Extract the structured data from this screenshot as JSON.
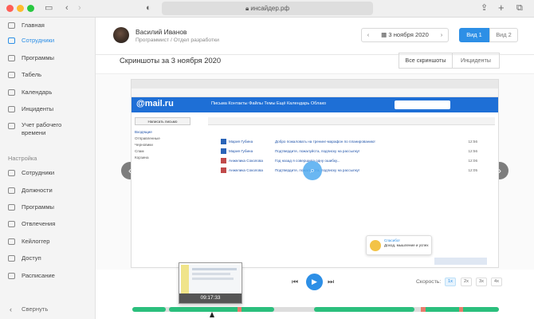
{
  "browser": {
    "address": "инсайдер.рф",
    "traffic_colors": [
      "#fe5f57",
      "#febc2e",
      "#28c840"
    ]
  },
  "sidebar": {
    "items": [
      {
        "label": "Главная",
        "icon": "home-icon"
      },
      {
        "label": "Сотрудники",
        "icon": "users-icon",
        "active": true
      },
      {
        "label": "Программы",
        "icon": "apps-icon"
      },
      {
        "label": "Табель",
        "icon": "table-icon"
      },
      {
        "label": "Календарь",
        "icon": "calendar-icon"
      },
      {
        "label": "Инциденты",
        "icon": "incident-icon"
      },
      {
        "label": "Учет рабочего",
        "icon": "clock-icon"
      },
      {
        "label": "времени",
        "icon": ""
      }
    ],
    "settings_title": "Настройка",
    "settings_items": [
      {
        "label": "Сотрудники",
        "icon": "users-icon"
      },
      {
        "label": "Должности",
        "icon": "badge-icon"
      },
      {
        "label": "Программы",
        "icon": "apps-icon"
      },
      {
        "label": "Отвлечения",
        "icon": "distraction-icon"
      },
      {
        "label": "Кейлоггер",
        "icon": "keyboard-icon"
      },
      {
        "label": "Доступ",
        "icon": "lock-icon"
      },
      {
        "label": "Расписание",
        "icon": "schedule-icon"
      }
    ],
    "collapse_label": "Свернуть"
  },
  "header": {
    "user_name": "Василий Иванов",
    "user_role": "Программист / Отдел разработки",
    "date": "3 ноября 2020",
    "view1": "Вид 1",
    "view2": "Вид 2"
  },
  "page": {
    "title": "Скриншоты за 3 ноября 2020",
    "tab_all": "Все скриншоты",
    "tab_incidents": "Инциденты"
  },
  "screenshot": {
    "logo": "@mail.ru",
    "nav": "Письма  Контакты  Файлы  Темы  Ещё   Календарь   Облако",
    "compose": "Написать письмо",
    "folders": [
      "Входящие",
      "Отправленные",
      "Черновики",
      "Спам",
      "Корзина"
    ],
    "rows": [
      {
        "from": "Мария Губина",
        "subject": "Добро пожаловать на тренинг-марафон по планированию!",
        "time": "12:56"
      },
      {
        "from": "Мария Губина",
        "subject": "Подтвердите, пожалуйста, подписку на рассылку!",
        "time": "12:56"
      },
      {
        "from": "Анжелика Соколова",
        "subject": "Год назад я совершила одну ошибку...",
        "time": "12:06"
      },
      {
        "from": "Анжелика Соколова",
        "subject": "Подтвердите, пожалуйста, подписку на рассылку!",
        "time": "12:05"
      }
    ],
    "toast_title": "Спасибо!",
    "toast_text": "Доход, мышление и успех"
  },
  "player": {
    "speed_label": "Скорость:",
    "speeds": [
      "1x",
      "2x",
      "3x",
      "4x"
    ],
    "thumb_time": "09:17:33"
  },
  "colors": {
    "accent": "#2d8fe6",
    "timeline_active": "#2bbf7d",
    "timeline_incident": "#e87c6c"
  }
}
